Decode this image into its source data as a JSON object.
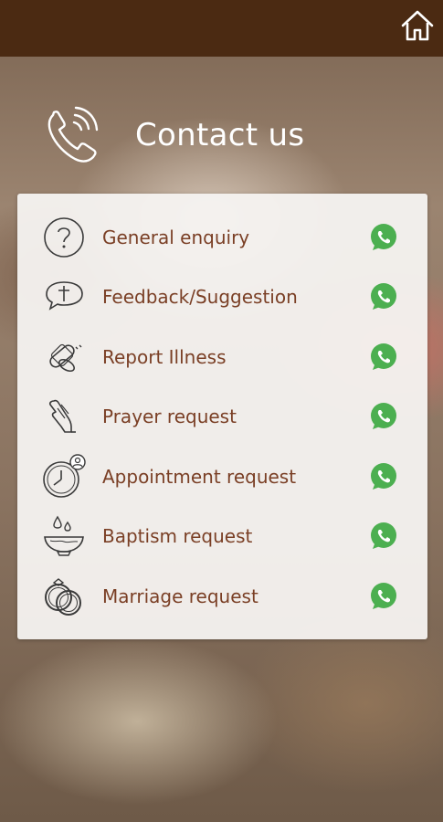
{
  "header": {
    "home_icon": "home-icon",
    "title": "Contact us",
    "title_icon": "phone-ringing-icon"
  },
  "colors": {
    "topbar": "#4b2a12",
    "label": "#7a3f25",
    "whatsapp": "#4caf50"
  },
  "contact_items": [
    {
      "label": "General enquiry",
      "icon": "question-icon",
      "action_icon": "whatsapp-icon"
    },
    {
      "label": "Feedback/Suggestion",
      "icon": "speech-cross-icon",
      "action_icon": "whatsapp-icon"
    },
    {
      "label": "Report Illness",
      "icon": "bandage-pill-icon",
      "action_icon": "whatsapp-icon"
    },
    {
      "label": "Prayer request",
      "icon": "praying-hands-icon",
      "action_icon": "whatsapp-icon"
    },
    {
      "label": "Appointment request",
      "icon": "clock-person-icon",
      "action_icon": "whatsapp-icon"
    },
    {
      "label": "Baptism request",
      "icon": "baptism-bowl-icon",
      "action_icon": "whatsapp-icon"
    },
    {
      "label": "Marriage request",
      "icon": "rings-icon",
      "action_icon": "whatsapp-icon"
    }
  ]
}
